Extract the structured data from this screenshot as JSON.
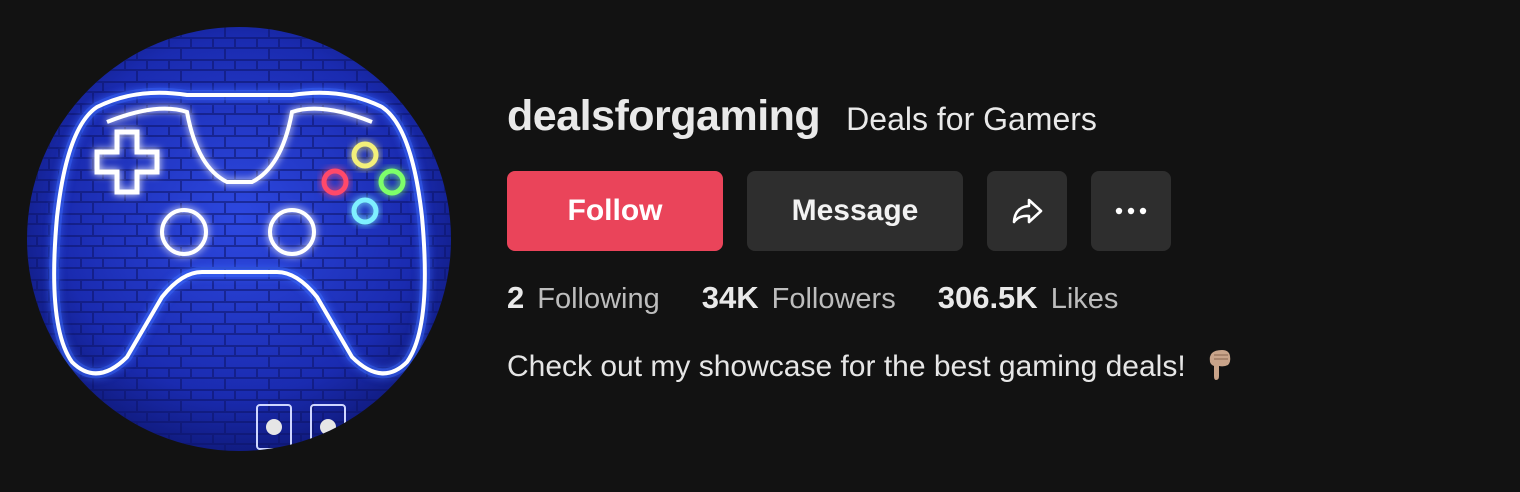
{
  "profile": {
    "username": "dealsforgaming",
    "nickname": "Deals for Gamers",
    "bio": "Check out my showcase for the best gaming deals!",
    "bio_emoji": "backhand-index-pointing-down-emoji"
  },
  "actions": {
    "follow_label": "Follow",
    "message_label": "Message",
    "share_icon": "share-arrow-icon",
    "more_icon": "more-horizontal-icon"
  },
  "stats": [
    {
      "value": "2",
      "label": "Following"
    },
    {
      "value": "34K",
      "label": "Followers"
    },
    {
      "value": "306.5K",
      "label": "Likes"
    }
  ],
  "colors": {
    "background": "#121212",
    "follow_button": "#ea445a",
    "secondary_button": "#2e2e2e",
    "avatar_bg": "#1a2cb0",
    "neon_outline": "#ffffff"
  }
}
